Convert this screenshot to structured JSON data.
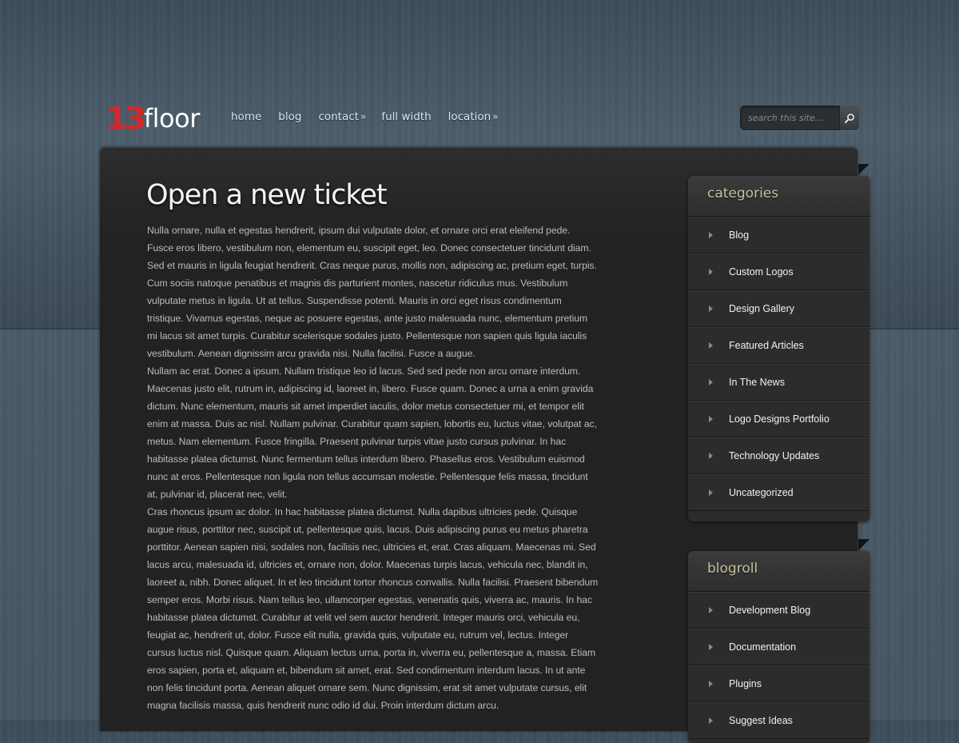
{
  "logo": {
    "number": "13",
    "word": "floor"
  },
  "nav": [
    {
      "label": "home",
      "arrow": ""
    },
    {
      "label": "blog",
      "arrow": ""
    },
    {
      "label": "contact",
      "arrow": "»"
    },
    {
      "label": "full width",
      "arrow": ""
    },
    {
      "label": "location",
      "arrow": "»"
    }
  ],
  "search": {
    "placeholder": "search this site..."
  },
  "page": {
    "title": "Open a new ticket",
    "paragraphs": [
      "Nulla ornare, nulla et egestas hendrerit, ipsum dui vulputate dolor, et ornare orci erat eleifend pede. Fusce eros libero, vestibulum non, elementum eu, suscipit eget, leo. Donec consectetuer tincidunt diam. Sed et mauris in ligula feugiat hendrerit. Cras neque purus, mollis non, adipiscing ac, pretium eget, turpis. Cum sociis natoque penatibus et magnis dis parturient montes, nascetur ridiculus mus. Vestibulum vulputate metus in ligula. Ut at tellus. Suspendisse potenti. Mauris in orci eget risus condimentum tristique. Vivamus egestas, neque ac posuere egestas, ante justo malesuada nunc, elementum pretium mi lacus sit amet turpis. Curabitur scelerisque sodales justo. Pellentesque non sapien quis ligula iaculis vestibulum. Aenean dignissim arcu gravida nisi. Nulla facilisi. Fusce a augue.",
      "Nullam ac erat. Donec a ipsum. Nullam tristique leo id lacus. Sed sed pede non arcu ornare interdum. Maecenas justo elit, rutrum in, adipiscing id, laoreet in, libero. Fusce quam. Donec a urna a enim gravida dictum. Nunc elementum, mauris sit amet imperdiet iaculis, dolor metus consectetuer mi, et tempor elit enim at massa. Duis ac nisl. Nullam pulvinar. Curabitur quam sapien, lobortis eu, luctus vitae, volutpat ac, metus. Nam elementum. Fusce fringilla. Praesent pulvinar turpis vitae justo cursus pulvinar. In hac habitasse platea dictumst. Nunc fermentum tellus interdum libero. Phasellus eros. Vestibulum euismod nunc at eros. Pellentesque non ligula non tellus accumsan molestie. Pellentesque felis massa, tincidunt at, pulvinar id, placerat nec, velit.",
      "Cras rhoncus ipsum ac dolor. In hac habitasse platea dictumst. Nulla dapibus ultricies pede. Quisque augue risus, porttitor nec, suscipit ut, pellentesque quis, lacus. Duis adipiscing purus eu metus pharetra porttitor. Aenean sapien nisi, sodales non, facilisis nec, ultricies et, erat. Cras aliquam. Maecenas mi. Sed lacus arcu, malesuada id, ultricies et, ornare non, dolor. Maecenas turpis lacus, vehicula nec, blandit in, laoreet a, nibh. Donec aliquet. In et leo tincidunt tortor rhoncus convallis. Nulla facilisi. Praesent bibendum semper eros. Morbi risus. Nam tellus leo, ullamcorper egestas, venenatis quis, viverra ac, mauris. In hac habitasse platea dictumst. Curabitur at velit vel sem auctor hendrerit. Integer mauris orci, vehicula eu, feugiat ac, hendrerit ut, dolor. Fusce elit nulla, gravida quis, vulputate eu, rutrum vel, lectus. Integer cursus luctus nisl. Quisque quam. Aliquam lectus urna, porta in, viverra eu, pellentesque a, massa. Etiam eros sapien, porta et, aliquam et, bibendum sit amet, erat. Sed condimentum interdum lacus. In ut ante non felis tincidunt porta. Aenean aliquet ornare sem. Nunc dignissim, erat sit amet vulputate cursus, elit magna facilisis massa, quis hendrerit nunc odio id dui. Proin interdum dictum arcu."
    ]
  },
  "sidebar": {
    "categories": {
      "title": "categories",
      "items": [
        "Blog",
        "Custom Logos",
        "Design Gallery",
        "Featured Articles",
        "In The News",
        "Logo Designs Portfolio",
        "Technology Updates",
        "Uncategorized"
      ]
    },
    "blogroll": {
      "title": "blogroll",
      "items": [
        "Development Blog",
        "Documentation",
        "Plugins",
        "Suggest Ideas"
      ]
    }
  },
  "colors": {
    "accent": "#d3272c",
    "panel": "#222222",
    "widget_title": "#c9c2a3"
  }
}
